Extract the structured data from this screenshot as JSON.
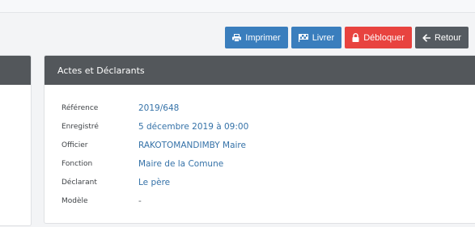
{
  "toolbar": {
    "print_label": "Imprimer",
    "deliver_label": "Livrer",
    "unlock_label": "Débloquer",
    "back_label": "Retour"
  },
  "panel": {
    "title": "Actes et Déclarants",
    "rows": [
      {
        "label": "Référence",
        "value": "2019/648"
      },
      {
        "label": "Enregistré",
        "value": "5 décembre 2019 à 09:00"
      },
      {
        "label": "Officier",
        "value": "RAKOTOMANDIMBY Maire"
      },
      {
        "label": "Fonction",
        "value": "Maire de la Comune"
      },
      {
        "label": "Déclarant",
        "value": "Le père"
      },
      {
        "label": "Modèle",
        "value": "-"
      }
    ]
  },
  "colors": {
    "primary": "#3a7ebd",
    "danger": "#e8433f",
    "dark": "#555b61",
    "panel_header": "#53575b",
    "link": "#3572a8"
  },
  "icons": {
    "print": "print-icon",
    "deliver": "flag-checkered-icon",
    "unlock": "lock-icon",
    "back": "arrow-left-icon"
  }
}
